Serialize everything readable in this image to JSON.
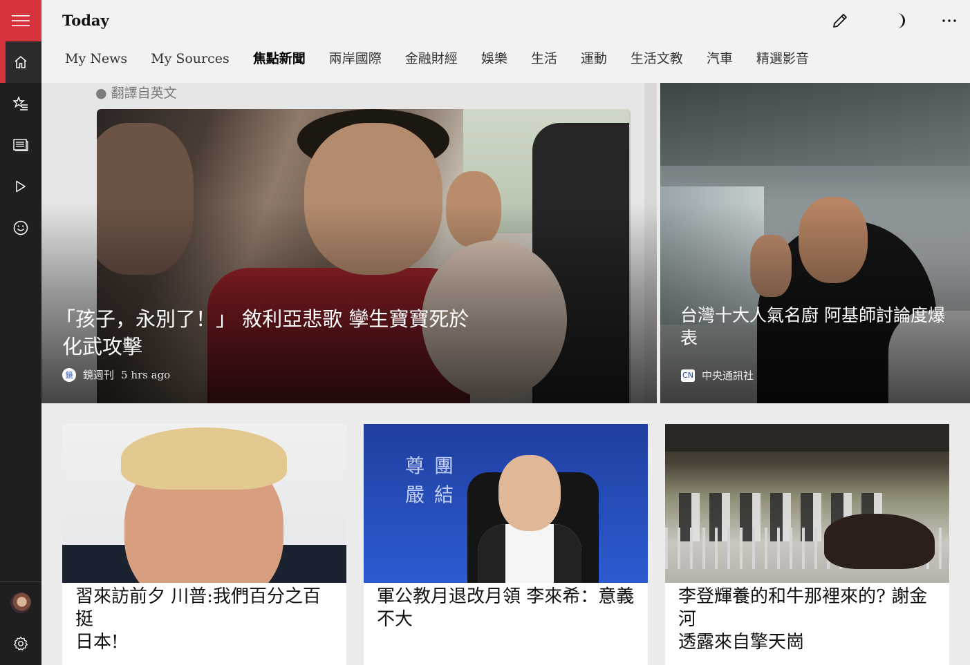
{
  "header": {
    "title": "Today",
    "tabs": [
      {
        "label": "My News",
        "active": false
      },
      {
        "label": "My Sources",
        "active": false
      },
      {
        "label": "焦點新聞",
        "active": true
      },
      {
        "label": "兩岸國際",
        "active": false
      },
      {
        "label": "金融財經",
        "active": false
      },
      {
        "label": "娛樂",
        "active": false
      },
      {
        "label": "生活",
        "active": false
      },
      {
        "label": "運動",
        "active": false
      },
      {
        "label": "生活文教",
        "active": false
      },
      {
        "label": "汽車",
        "active": false
      },
      {
        "label": "精選影音",
        "active": false
      }
    ],
    "icons": [
      "pencil-icon",
      "moon-icon",
      "more-icon"
    ]
  },
  "sidebar": {
    "accent": "#d7333c",
    "items": [
      "menu-icon",
      "home-icon",
      "favorites-icon",
      "news-icon",
      "play-icon",
      "smiley-icon"
    ],
    "bottom": [
      "avatar",
      "settings-icon"
    ]
  },
  "hero": [
    {
      "translate_label": "翻譯自英文",
      "title_line1": "「孩子，永別了！」 敘利亞悲歌 孿生寶寶死於",
      "title_line2": "化武攻擊",
      "source": "鏡週刊",
      "time": "5 hrs ago"
    },
    {
      "title_line1": "台灣十大人氣名廚 阿基師討論度爆",
      "title_line2": "表",
      "source": "中央通訊社"
    }
  ],
  "cards": [
    {
      "title_line1": "習來訪前夕 川普:我們百分之百挺",
      "title_line2": "日本!"
    },
    {
      "title_line1": "軍公教月退改月領 李來希：意義",
      "title_line2": "不大",
      "photo_text": [
        "尊",
        "團",
        "嚴",
        "結"
      ]
    },
    {
      "title_line1": "李登輝養的和牛那裡來的? 謝金河",
      "title_line2": "透露來自擎天崗"
    }
  ]
}
